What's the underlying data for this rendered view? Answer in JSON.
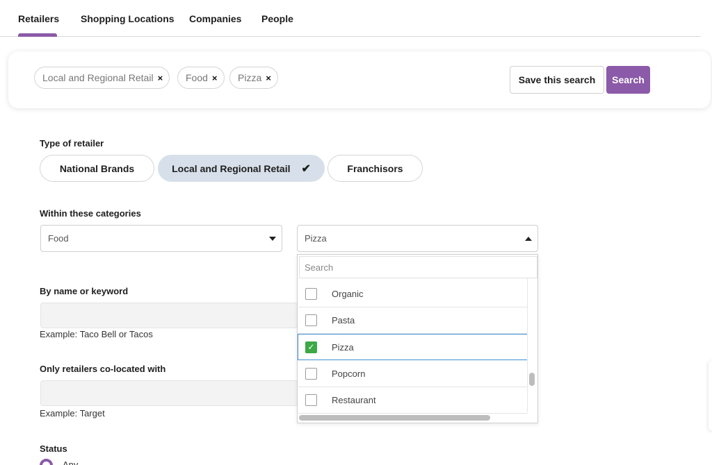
{
  "colors": {
    "accent": "#8b5aa8",
    "pill_selected_bg": "#d7e0ea",
    "check_green": "#3ca846",
    "focus_border": "#3d8fd6"
  },
  "tabs": [
    {
      "label": "Retailers",
      "active": true
    },
    {
      "label": "Shopping Locations",
      "active": false
    },
    {
      "label": "Companies",
      "active": false
    },
    {
      "label": "People",
      "active": false
    }
  ],
  "search_bar": {
    "chips": [
      {
        "label": "Local and Regional Retail",
        "remove": "×"
      },
      {
        "label": "Food",
        "remove": "×"
      },
      {
        "label": "Pizza",
        "remove": "×"
      }
    ],
    "save_label": "Save this search",
    "search_label": "Search"
  },
  "retailer_type": {
    "label": "Type of retailer",
    "options": [
      {
        "label": "National Brands",
        "selected": false
      },
      {
        "label": "Local and Regional Retail",
        "selected": true,
        "icon": "checkmark-icon",
        "glyph": "✔"
      },
      {
        "label": "Franchisors",
        "selected": false
      }
    ]
  },
  "categories": {
    "label": "Within these categories",
    "category_value": "Food",
    "subcategory_value": "Pizza",
    "dropdown": {
      "search_placeholder": "Search",
      "items": [
        {
          "label": "Organic",
          "checked": false
        },
        {
          "label": "Pasta",
          "checked": false
        },
        {
          "label": "Pizza",
          "checked": true,
          "glyph": "✓"
        },
        {
          "label": "Popcorn",
          "checked": false
        },
        {
          "label": "Restaurant",
          "checked": false
        }
      ]
    }
  },
  "keyword": {
    "label": "By name or keyword",
    "value": "",
    "hint": "Example: Taco Bell or Tacos"
  },
  "colocated": {
    "label": "Only retailers co-located with",
    "value": "",
    "hint": "Example: Target"
  },
  "status": {
    "label": "Status",
    "options": [
      {
        "label": "Any",
        "selected": true
      }
    ]
  }
}
